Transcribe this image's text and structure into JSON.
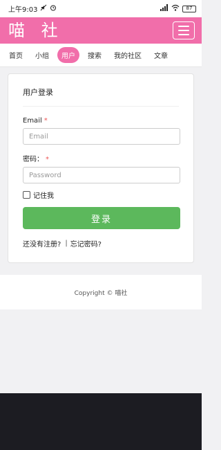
{
  "status_bar": {
    "time": "上午9:03",
    "battery": "87"
  },
  "header": {
    "logo": "喵 社"
  },
  "nav": {
    "items": [
      "首页",
      "小组",
      "用户",
      "搜索",
      "我的社区",
      "文章"
    ]
  },
  "login_card": {
    "title": "用户登录",
    "email_label": "Email",
    "email_placeholder": "Email",
    "password_label": "密码：",
    "password_placeholder": "Password",
    "required_mark": "*",
    "remember_label": "记住我",
    "submit_label": "登录",
    "register_link": "还没有注册?",
    "separator": "|",
    "forgot_link": "忘记密码?"
  },
  "footer": {
    "copyright": "Copyright © 喵社"
  }
}
